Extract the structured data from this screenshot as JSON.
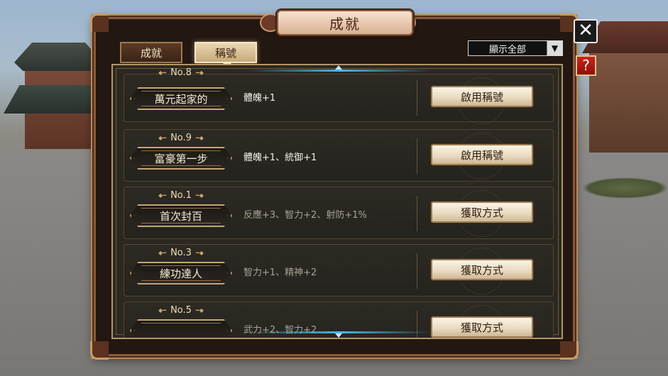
{
  "window": {
    "title": "成就"
  },
  "tabs": [
    {
      "label": "成就",
      "active": false
    },
    {
      "label": "稱號",
      "active": true
    }
  ],
  "filter": {
    "selected": "顯示全部"
  },
  "controls": {
    "close": "✕",
    "help": "?"
  },
  "rows": [
    {
      "number": "No.8",
      "name": "萬元起家的",
      "bonus": "體魄+1",
      "action": "啟用稱號",
      "unlocked": true
    },
    {
      "number": "No.9",
      "name": "富豪第一步",
      "bonus": "體魄+1、統御+1",
      "action": "啟用稱號",
      "unlocked": true
    },
    {
      "number": "No.1",
      "name": "首次封百",
      "bonus": "反應+3、智力+2、射防+1%",
      "action": "獲取方式",
      "unlocked": false
    },
    {
      "number": "No.3",
      "name": "練功達人",
      "bonus": "智力+1、精神+2",
      "action": "獲取方式",
      "unlocked": false
    },
    {
      "number": "No.5",
      "name": "",
      "bonus": "武力+2、智力+2",
      "action": "獲取方式",
      "unlocked": false
    }
  ]
}
